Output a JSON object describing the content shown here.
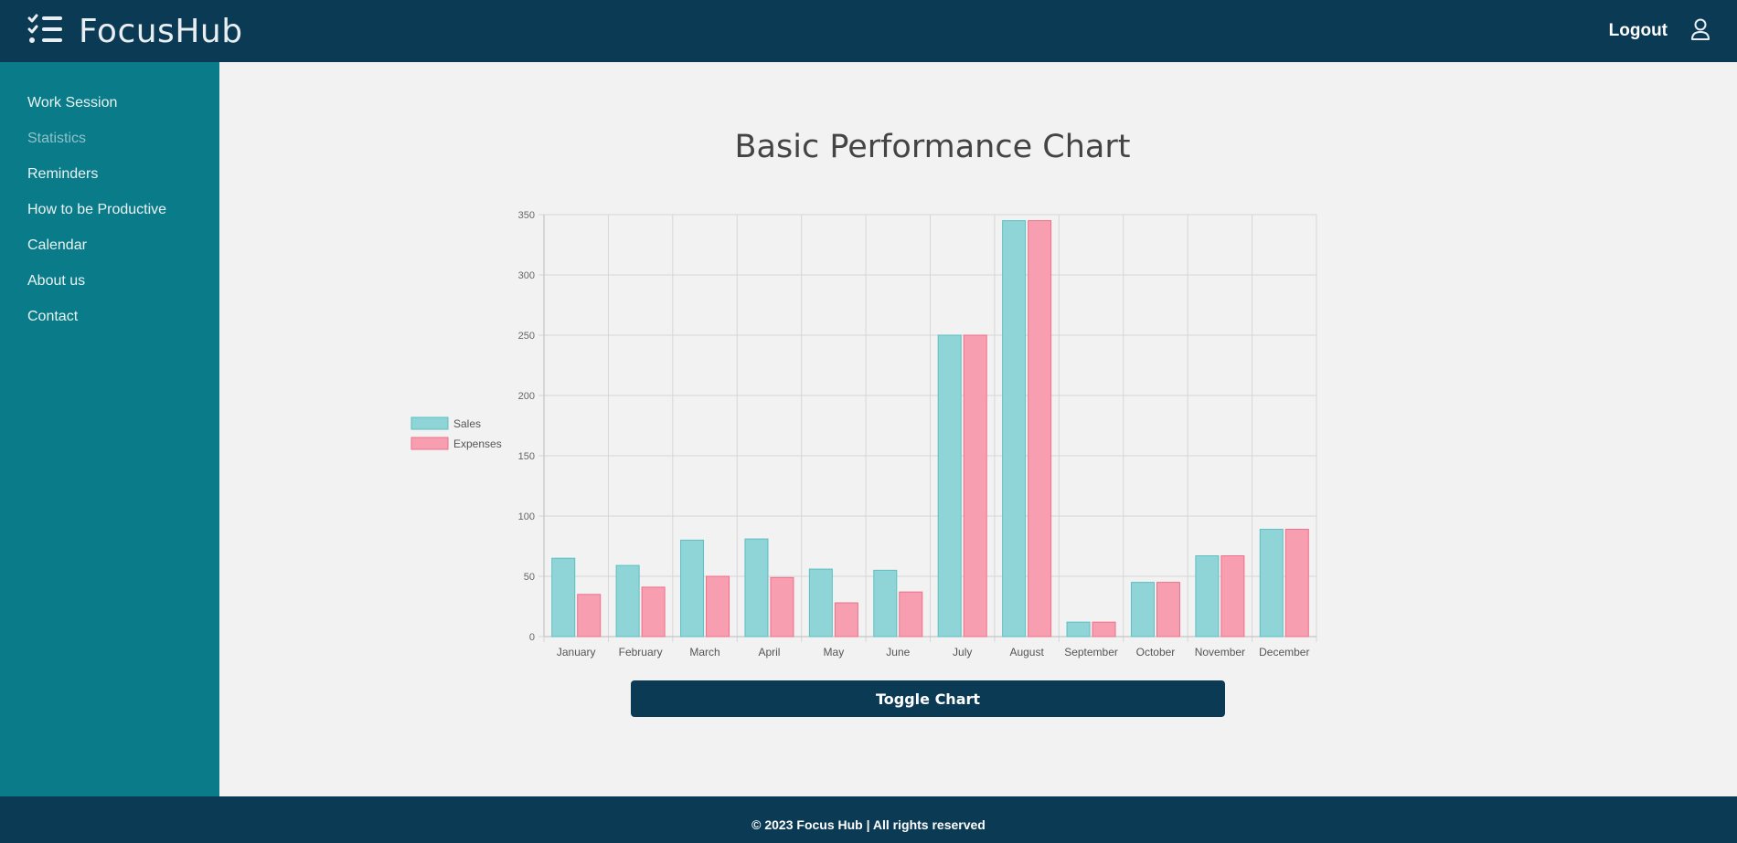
{
  "header": {
    "brand": "FocusHub",
    "logout_label": "Logout",
    "logo_icon": "checklist-icon",
    "user_icon": "user-icon"
  },
  "sidebar": {
    "items": [
      {
        "label": "Work Session",
        "active": false
      },
      {
        "label": "Statistics",
        "active": true
      },
      {
        "label": "Reminders",
        "active": false
      },
      {
        "label": "How to be Productive",
        "active": false
      },
      {
        "label": "Calendar",
        "active": false
      },
      {
        "label": "About us",
        "active": false
      },
      {
        "label": "Contact",
        "active": false
      }
    ]
  },
  "main": {
    "title": "Basic Performance Chart",
    "toggle_label": "Toggle Chart"
  },
  "footer": {
    "text": "© 2023 Focus Hub | All rights reserved"
  },
  "colors": {
    "header_bg": "#0b3a55",
    "sidebar_bg": "#0a7b89",
    "sales_fill": "#8fd5d8",
    "sales_stroke": "#5bbfc4",
    "expenses_fill": "#f79fb0",
    "expenses_stroke": "#ef6f88"
  },
  "chart_data": {
    "type": "bar",
    "categories": [
      "January",
      "February",
      "March",
      "April",
      "May",
      "June",
      "July",
      "August",
      "September",
      "October",
      "November",
      "December"
    ],
    "series": [
      {
        "name": "Sales",
        "values": [
          65,
          59,
          80,
          81,
          56,
          55,
          250,
          345,
          12,
          45,
          67,
          89
        ]
      },
      {
        "name": "Expenses",
        "values": [
          35,
          41,
          50,
          49,
          28,
          37,
          250,
          345,
          12,
          45,
          67,
          89
        ]
      }
    ],
    "yticks": [
      0,
      50,
      100,
      150,
      200,
      250,
      300,
      350
    ],
    "ylim": [
      0,
      350
    ],
    "grid": true,
    "legend": "left"
  }
}
